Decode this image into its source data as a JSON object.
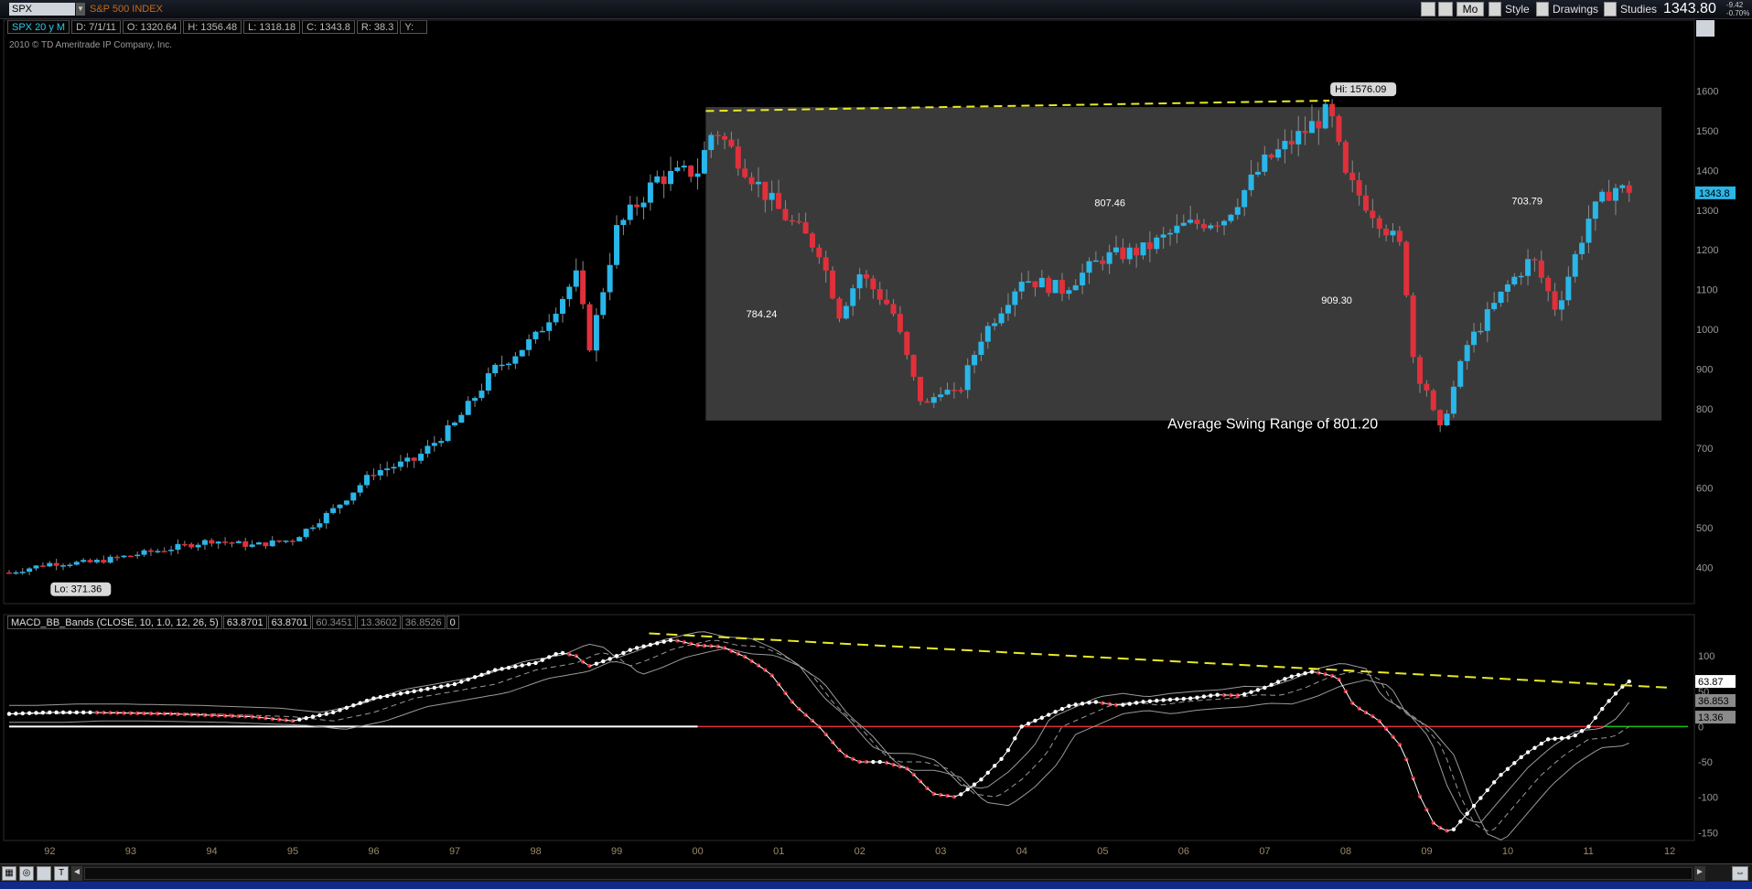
{
  "toolbar": {
    "symbol": "SPX",
    "symbol_description": "S&P 500 INDEX",
    "mode_label": "Mo",
    "style_label": "Style",
    "drawings_label": "Drawings",
    "studies_label": "Studies",
    "last_price": "1343.80",
    "change_abs": "-9.42",
    "change_pct": "-0.70%"
  },
  "info_bar": {
    "period": "SPX 20 y M",
    "date": "D: 7/1/11",
    "open": "O: 1320.64",
    "high": "H: 1356.48",
    "low": "L: 1318.18",
    "close": "C: 1343.8",
    "range": "R: 38.3",
    "y": "Y:"
  },
  "copyright": "2010 © TD Ameritrade IP Company, Inc.",
  "annotations": {
    "hi_label": "Hi: 1576.09",
    "lo_label": "Lo: 371.36",
    "swing_1": "784.24",
    "swing_2": "807.46",
    "swing_3": "909.30",
    "swing_4": "703.79",
    "avg_swing": "Average Swing Range of 801.20"
  },
  "macd_bar": {
    "title": "MACD_BB_Bands (CLOSE, 10, 1.0, 12, 26, 5)",
    "v1": "63.8701",
    "v2": "63.8701",
    "v3": "60.3451",
    "v4": "13.3602",
    "v5": "36.8526",
    "v6": "0"
  },
  "macd_labels": {
    "current": "63.87",
    "upper": "36.853",
    "lower": "13.36"
  },
  "price_label": "1343.8",
  "colors": {
    "up": "#29b6e8",
    "down": "#e0303a",
    "dash": "#e8e82a",
    "box": "#3a3a3a"
  },
  "chart_data": [
    {
      "type": "candlestick",
      "title": "S&P 500 INDEX",
      "ylim": [
        350,
        1650
      ],
      "y_ticks": [
        400,
        500,
        600,
        700,
        800,
        900,
        1000,
        1100,
        1200,
        1300,
        1400,
        1500,
        1600
      ],
      "x_ticks": [
        "92",
        "93",
        "94",
        "95",
        "96",
        "97",
        "98",
        "99",
        "00",
        "01",
        "02",
        "03",
        "04",
        "05",
        "06",
        "07",
        "08",
        "09",
        "10",
        "11",
        "12"
      ],
      "xlim": [
        1991.5,
        2012.0
      ],
      "x_tick_years": [
        1992,
        1993,
        1994,
        1995,
        1996,
        1997,
        1998,
        1999,
        2000,
        2001,
        2002,
        2003,
        2004,
        2005,
        2006,
        2007,
        2008,
        2009,
        2010,
        2011,
        2012
      ],
      "close_path": [
        [
          1991.5,
          387
        ],
        [
          1992.0,
          410
        ],
        [
          1992.5,
          412
        ],
        [
          1993.0,
          430
        ],
        [
          1993.5,
          448
        ],
        [
          1994.0,
          468
        ],
        [
          1994.5,
          455
        ],
        [
          1995.0,
          470
        ],
        [
          1995.5,
          545
        ],
        [
          1996.0,
          640
        ],
        [
          1996.5,
          670
        ],
        [
          1997.0,
          760
        ],
        [
          1997.5,
          900
        ],
        [
          1998.0,
          980
        ],
        [
          1998.5,
          1133
        ],
        [
          1998.67,
          957
        ],
        [
          1999.0,
          1250
        ],
        [
          1999.5,
          1380
        ],
        [
          2000.0,
          1400
        ],
        [
          2000.2,
          1510
        ],
        [
          2000.5,
          1430
        ],
        [
          2000.8,
          1350
        ],
        [
          2001.0,
          1300
        ],
        [
          2001.5,
          1200
        ],
        [
          2001.75,
          1040
        ],
        [
          2002.0,
          1140
        ],
        [
          2002.4,
          1050
        ],
        [
          2002.7,
          850
        ],
        [
          2002.8,
          800
        ],
        [
          2003.0,
          850
        ],
        [
          2003.2,
          830
        ],
        [
          2003.5,
          980
        ],
        [
          2004.0,
          1130
        ],
        [
          2004.5,
          1100
        ],
        [
          2005.0,
          1180
        ],
        [
          2005.5,
          1200
        ],
        [
          2006.0,
          1260
        ],
        [
          2006.5,
          1280
        ],
        [
          2007.0,
          1420
        ],
        [
          2007.5,
          1500
        ],
        [
          2007.8,
          1550
        ],
        [
          2008.0,
          1380
        ],
        [
          2008.4,
          1280
        ],
        [
          2008.7,
          1200
        ],
        [
          2008.85,
          900
        ],
        [
          2009.0,
          850
        ],
        [
          2009.15,
          735
        ],
        [
          2009.5,
          960
        ],
        [
          2010.0,
          1110
        ],
        [
          2010.3,
          1180
        ],
        [
          2010.6,
          1050
        ],
        [
          2011.0,
          1280
        ],
        [
          2011.3,
          1360
        ],
        [
          2011.5,
          1343.8
        ]
      ],
      "box": {
        "x0": 2000.1,
        "x1": 2011.9,
        "y0": 770,
        "y1": 1560
      },
      "trendline": [
        [
          2000.1,
          1550
        ],
        [
          2007.8,
          1576.09
        ]
      ],
      "hi": [
        2007.8,
        1576.09
      ],
      "lo": [
        1992.0,
        371.36
      ],
      "last": 1343.8,
      "swing_annotations": [
        {
          "x": 2000.6,
          "y": 1030,
          "label": "784.24"
        },
        {
          "x": 2004.9,
          "y": 1310,
          "label": "807.46"
        },
        {
          "x": 2007.7,
          "y": 1065,
          "label": "909.30"
        },
        {
          "x": 2010.05,
          "y": 1315,
          "label": "703.79"
        },
        {
          "x": 2005.8,
          "y": 750,
          "label": "Average Swing Range of 801.20"
        }
      ]
    },
    {
      "type": "line",
      "title": "MACD_BB_Bands (CLOSE, 10, 1.0, 12, 26, 5)",
      "ylim": [
        -160,
        130
      ],
      "y_ticks": [
        100,
        50,
        0,
        -50,
        -100,
        -150
      ],
      "xlim": [
        1991.5,
        2012.0
      ],
      "macd": [
        [
          1991.5,
          18
        ],
        [
          1992.0,
          20
        ],
        [
          1992.5,
          20
        ],
        [
          1993.0,
          19
        ],
        [
          1993.5,
          18
        ],
        [
          1994.0,
          16
        ],
        [
          1994.5,
          14
        ],
        [
          1995.0,
          8
        ],
        [
          1995.5,
          20
        ],
        [
          1996.0,
          40
        ],
        [
          1996.5,
          50
        ],
        [
          1997.0,
          60
        ],
        [
          1997.5,
          80
        ],
        [
          1998.0,
          90
        ],
        [
          1998.3,
          105
        ],
        [
          1998.5,
          100
        ],
        [
          1998.65,
          85
        ],
        [
          1998.9,
          95
        ],
        [
          1999.2,
          110
        ],
        [
          1999.5,
          118
        ],
        [
          1999.7,
          123
        ],
        [
          2000.0,
          115
        ],
        [
          2000.3,
          113
        ],
        [
          2000.6,
          98
        ],
        [
          2000.9,
          75
        ],
        [
          2001.2,
          30
        ],
        [
          2001.5,
          0
        ],
        [
          2001.8,
          -40
        ],
        [
          2002.0,
          -50
        ],
        [
          2002.3,
          -50
        ],
        [
          2002.6,
          -60
        ],
        [
          2002.9,
          -95
        ],
        [
          2003.2,
          -100
        ],
        [
          2003.5,
          -75
        ],
        [
          2003.8,
          -40
        ],
        [
          2004.0,
          0
        ],
        [
          2004.3,
          15
        ],
        [
          2004.6,
          30
        ],
        [
          2004.9,
          35
        ],
        [
          2005.2,
          30
        ],
        [
          2005.5,
          35
        ],
        [
          2005.8,
          38
        ],
        [
          2006.1,
          40
        ],
        [
          2006.4,
          45
        ],
        [
          2006.7,
          44
        ],
        [
          2007.0,
          55
        ],
        [
          2007.3,
          70
        ],
        [
          2007.6,
          78
        ],
        [
          2007.9,
          70
        ],
        [
          2008.1,
          30
        ],
        [
          2008.4,
          10
        ],
        [
          2008.7,
          -30
        ],
        [
          2008.9,
          -95
        ],
        [
          2009.1,
          -140
        ],
        [
          2009.3,
          -150
        ],
        [
          2009.6,
          -110
        ],
        [
          2009.9,
          -70
        ],
        [
          2010.2,
          -40
        ],
        [
          2010.5,
          -18
        ],
        [
          2010.8,
          -15
        ],
        [
          2011.0,
          0
        ],
        [
          2011.2,
          30
        ],
        [
          2011.4,
          55
        ],
        [
          2011.5,
          63.87
        ]
      ],
      "trendline": [
        [
          1999.4,
          132
        ],
        [
          2012.0,
          55
        ]
      ],
      "zero": 0,
      "current": 63.87,
      "upper": 36.853,
      "lower": 13.36
    }
  ]
}
